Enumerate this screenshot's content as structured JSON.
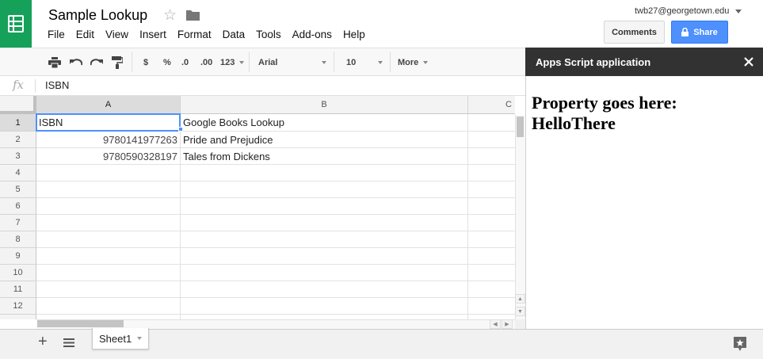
{
  "header": {
    "title": "Sample Lookup",
    "account": "twb27@georgetown.edu",
    "comments_label": "Comments",
    "share_label": "Share"
  },
  "menu": [
    "File",
    "Edit",
    "View",
    "Insert",
    "Format",
    "Data",
    "Tools",
    "Add-ons",
    "Help"
  ],
  "toolbar": {
    "currency": "$",
    "percent": "%",
    "decrease_decimal": ".0",
    "increase_decimal": ".00",
    "number_format": "123",
    "font": "Arial",
    "font_size": "10",
    "more": "More"
  },
  "formula_bar": {
    "fx": "fx",
    "value": "ISBN"
  },
  "grid": {
    "columns": [
      "A",
      "B",
      "C"
    ],
    "rows": [
      "1",
      "2",
      "3",
      "4",
      "5",
      "6",
      "7",
      "8",
      "9",
      "10",
      "11",
      "12"
    ],
    "cells": [
      [
        "ISBN",
        "Google Books Lookup",
        ""
      ],
      [
        "9780141977263",
        "Pride and Prejudice",
        ""
      ],
      [
        "9780590328197",
        "Tales from Dickens",
        ""
      ]
    ],
    "active_cell": "A1"
  },
  "sheets": [
    "Sheet1"
  ],
  "side_panel": {
    "title": "Apps Script application",
    "content": "Property goes here: HelloThere"
  },
  "colors": {
    "logo_green": "#16a15a",
    "share_blue": "#4d90fe",
    "panel_header": "#323232"
  }
}
